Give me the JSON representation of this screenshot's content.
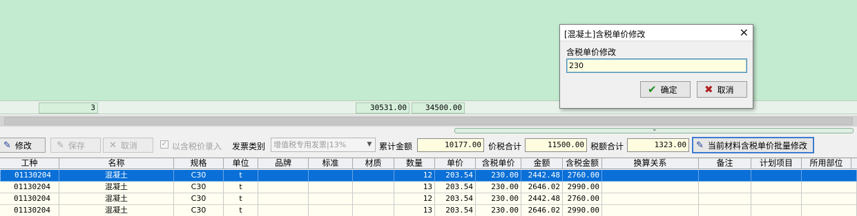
{
  "summary": {
    "qty": "3",
    "amount": "30531.00",
    "tax_amount": "34500.00"
  },
  "toolbar": {
    "modify_label": "修改",
    "save_label": "保存",
    "cancel_label": "取消",
    "tax_entry_label": "以含税价录入",
    "invoice_type_label": "发票类别",
    "invoice_type_value": "增值税专用发票|13%",
    "total_amount_label": "累计金额",
    "total_amount_value": "10177.00",
    "total_price_tax_label": "价税合计",
    "total_price_tax_value": "11500.00",
    "total_tax_label": "税额合计",
    "total_tax_value": "1323.00",
    "batch_modify_label": "当前材料含税单价批量修改"
  },
  "grid": {
    "columns": [
      "工种",
      "名称",
      "规格",
      "单位",
      "品牌",
      "标准",
      "材质",
      "数量",
      "单价",
      "含税单价",
      "金额",
      "含税金额",
      "换算关系",
      "备注",
      "计划项目",
      "所用部位"
    ],
    "rows": [
      [
        "01130204",
        "混凝土",
        "C30",
        "t",
        "",
        "",
        "",
        "12",
        "203.54",
        "230.00",
        "2442.48",
        "2760.00",
        "",
        "",
        "",
        ""
      ],
      [
        "01130204",
        "混凝土",
        "C30",
        "t",
        "",
        "",
        "",
        "13",
        "203.54",
        "230.00",
        "2646.02",
        "2990.00",
        "",
        "",
        "",
        ""
      ],
      [
        "01130204",
        "混凝土",
        "C30",
        "t",
        "",
        "",
        "",
        "12",
        "203.54",
        "230.00",
        "2442.48",
        "2760.00",
        "",
        "",
        "",
        ""
      ],
      [
        "01130204",
        "混凝土",
        "C30",
        "t",
        "",
        "",
        "",
        "13",
        "203.54",
        "230.00",
        "2646.02",
        "2990.00",
        "",
        "",
        "",
        ""
      ]
    ]
  },
  "dialog": {
    "title": "[混凝土]含税单价修改",
    "field_label": "含税单价修改",
    "field_value": "230",
    "ok_label": "确定",
    "cancel_label": "取消"
  },
  "colors": {
    "selected_row": "#0a6fd6",
    "panel_green": "#c3ebd0",
    "input_yellow": "#fffde0"
  },
  "icons": [
    "pencil-icon",
    "checkmark-icon",
    "close-x-icon",
    "chevron-down-icon"
  ]
}
